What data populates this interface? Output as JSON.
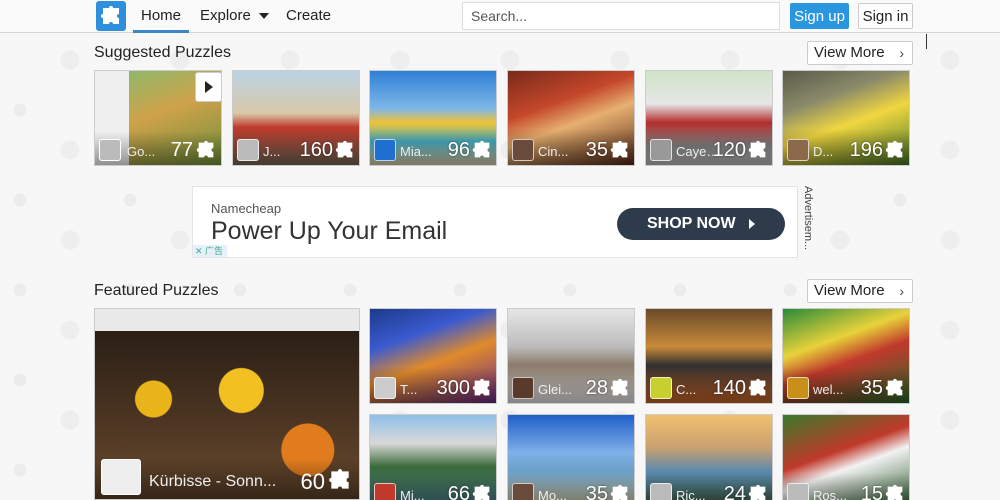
{
  "nav": {
    "home": "Home",
    "explore": "Explore",
    "create": "Create",
    "search_placeholder": "Search...",
    "signup": "Sign up",
    "signin": "Sign in"
  },
  "suggested": {
    "title": "Suggested Puzzles",
    "view_more": "View More",
    "tiles": [
      {
        "name": "Go...",
        "count": "77"
      },
      {
        "name": "J...",
        "count": "160"
      },
      {
        "name": "Mia...",
        "count": "96"
      },
      {
        "name": "Cin...",
        "count": "35"
      },
      {
        "name": "Cayen...",
        "count": "120"
      },
      {
        "name": "D...",
        "count": "196"
      }
    ]
  },
  "ad": {
    "brand": "Namecheap",
    "headline": "Power Up Your Email",
    "cta": "SHOP NOW",
    "side_label": "Advertisem...",
    "choices": "✕ 广告"
  },
  "featured": {
    "title": "Featured Puzzles",
    "view_more": "View More",
    "main": {
      "name": "Kürbisse - Sonn...",
      "count": "60"
    },
    "tiles": [
      {
        "name": "T...",
        "count": "300"
      },
      {
        "name": "Glei...",
        "count": "28"
      },
      {
        "name": "C...",
        "count": "140"
      },
      {
        "name": "wel...",
        "count": "35"
      },
      {
        "name": "Mi...",
        "count": "66"
      },
      {
        "name": "Mo...",
        "count": "35"
      },
      {
        "name": "Ric...",
        "count": "24"
      },
      {
        "name": "Ros...",
        "count": "15"
      }
    ]
  }
}
